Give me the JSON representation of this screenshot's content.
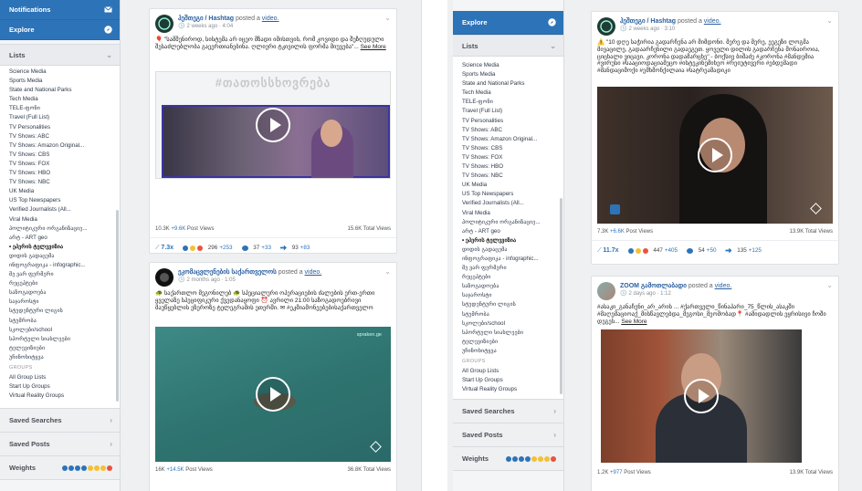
{
  "left": {
    "sidebar": {
      "notifications": "Notifications",
      "explore": "Explore",
      "lists_header": "Lists",
      "lists": [
        "Science Media",
        "Sports Media",
        "State and National Parks",
        "Tech Media",
        "TELE-ფონი",
        "Travel (Full List)",
        "TV Personalities",
        "TV Shows: ABC",
        "TV Shows: Amazon Original...",
        "TV Shows: CBS",
        "TV Shows: FOX",
        "TV Shows: HBO",
        "TV Shows: NBC",
        "UK Media",
        "US Top Newspapers",
        "Verified Journalists (All...",
        "Viral Media",
        "პოლიტიკური ორგანიზაციე...",
        "არტ - ART geo",
        "• ეპერის ტელევიზია",
        "დიდის გადაცემა",
        "ინფოგრაფიკა - infographic...",
        "მე ვარ ფერმერი",
        "რეცეპტები",
        "საზოგადოება",
        "საჯაროსტი",
        "სტუდენტური ლიგის",
        "სტუმრობა",
        "სკოლები/school",
        "სპორტული სიახლეები",
        "ტელევიზიები",
        "უჩინოხიტყვა"
      ],
      "groups_label": "GROUPS",
      "groups": [
        "All Group Lists",
        "Start Up Groups",
        "Virtual Reality Groups"
      ],
      "saved_searches": "Saved Searches",
      "saved_posts": "Saved Posts",
      "weights": "Weights"
    },
    "cards": [
      {
        "page": "ჰეშთეგი / Hashtag",
        "action": " posted a ",
        "link": "video.",
        "time": "2 weeks ago · 4:04",
        "text": "🎈 \"სამშენიროდ, სისტემა არ იცეო მზადი იმისთვის, რომ კოვიდი და შეზღუდული შესაძლებლობა გაეერთიანებინა. ღლიერი ტკივილის ფორმა მიუვება\"...",
        "more": "See More",
        "overlay": "#თათოსსხოვრება",
        "views_left": "10.3K",
        "views_left_inc": "+9.6K",
        "views_left_label": "Post Views",
        "views_right": "15.6K Total Views",
        "mult": "7.3x",
        "reactions": "296",
        "reactions_inc": "+253",
        "comments": "37",
        "comments_inc": "+33",
        "shares": "93",
        "shares_inc": "+83"
      },
      {
        "page": "ეკომაცვლენების საქართველოს",
        "action": " posted a ",
        "link": "video.",
        "time": "2 months ago · 1:05",
        "text": "🐢 საქართლო მეგონილებ 🐢 სპეციალური ოპერაციების ძალების ერთ-ერთი ყველაზე სპეციფიკური ქვედანაყოფი ⏰ ავრილი 21:00 საზოგადოებრივი მაუწყებლის ეზეროზე ტელეგრამის ეთერში. ✉ #ეკმიამონეებებისაქართველო",
        "more": "",
        "watermark": "spraken.ge",
        "views_left": "16K",
        "views_left_inc": "+14.5K",
        "views_left_label": "Post Views",
        "views_right": "36.8K Total Views"
      }
    ]
  },
  "right": {
    "sidebar": {
      "explore": "Explore",
      "lists_header": "Lists",
      "lists": [
        "Science Media",
        "Sports Media",
        "State and National Parks",
        "Tech Media",
        "TELE-ფონი",
        "Travel (Full List)",
        "TV Personalities",
        "TV Shows: ABC",
        "TV Shows: Amazon Original...",
        "TV Shows: CBS",
        "TV Shows: FOX",
        "TV Shows: HBO",
        "TV Shows: NBC",
        "UK Media",
        "US Top Newspapers",
        "Verified Journalists (All...",
        "Viral Media",
        "პოლიტიკური ორგანიზაციე...",
        "არტ - ART geo",
        "• ეპერის ტელევიზია",
        "დიდის გადაცემა",
        "ინფოგრაფიკა - infographic...",
        "მე ვარ ფერმერი",
        "რეცეპტები",
        "საზოგადოება",
        "საჯაროსტი",
        "სტუდენტური ლიგის",
        "სტუმრობა",
        "სკოლები/school",
        "სპორტული სიახლეები",
        "ტელევიზიები",
        "უჩინოხიტყვა"
      ],
      "groups_label": "GROUPS",
      "groups": [
        "All Group Lists",
        "Start Up Groups",
        "Virtual Reality Groups"
      ],
      "saved_searches": "Saved Searches",
      "saved_posts": "Saved Posts",
      "weights": "Weights"
    },
    "cards": [
      {
        "page": "ჰეშთეგი / Hashtag",
        "action": " posted a ",
        "link": "video.",
        "time": "2 weeks ago · 3:10",
        "text": "⚠️ \"10 დღე საჭირია გადარჩენა არ მიმდონი. მერე და მერე, ეეგეზი ლოგმა მივაცილე, გადაარჩენილი გადაეგეთ. ყოველი დილის გადარჩენა მონაიროია, ციცხალი ვიცავი, კორონა დადამარცხე\" - ბოქსივ ბიშაძე #კორონა #მანდემია #ვირუსი #სააციოდაციამეცო #ისტეკინემიხეო #რეიუტივერი #ებდემადი #მანდაციმოქი #ემხმონქილაია #სატრეამადიკი",
        "more": "",
        "views_left": "7.3K",
        "views_left_inc": "+6.6K",
        "views_left_label": "Post Views",
        "views_right": "13.9K Total Views",
        "mult": "11.7x",
        "reactions": "447",
        "reactions_inc": "+405",
        "comments": "54",
        "comments_inc": "+50",
        "shares": "135",
        "shares_inc": "+125"
      },
      {
        "page": "ZOOM გამოთლაბადი",
        "action": " posted a ",
        "link": "video.",
        "time": "2 days ago · 1:12",
        "text": "#ასაკი_განაჩენი_არ_არის ... #ქართველი_წინაპარი_75_წლის_ასაკში #მაღემაციოაქ_მისწავლებდა_მეგოსი_მეომობად📍 #ამიდადლის ეყრისივი ჩოში დეგეს...",
        "more": "See More",
        "views_left": "1.2K",
        "views_left_inc": "+977",
        "views_left_label": "Post Views",
        "views_right": "13.9K Total Views"
      }
    ]
  },
  "colors": {
    "accent": "#2d73b8",
    "link": "#2a5fa0"
  },
  "icons": {
    "notifications": "envelope-icon",
    "explore": "compass-icon",
    "chevron": "chevron-icon"
  }
}
